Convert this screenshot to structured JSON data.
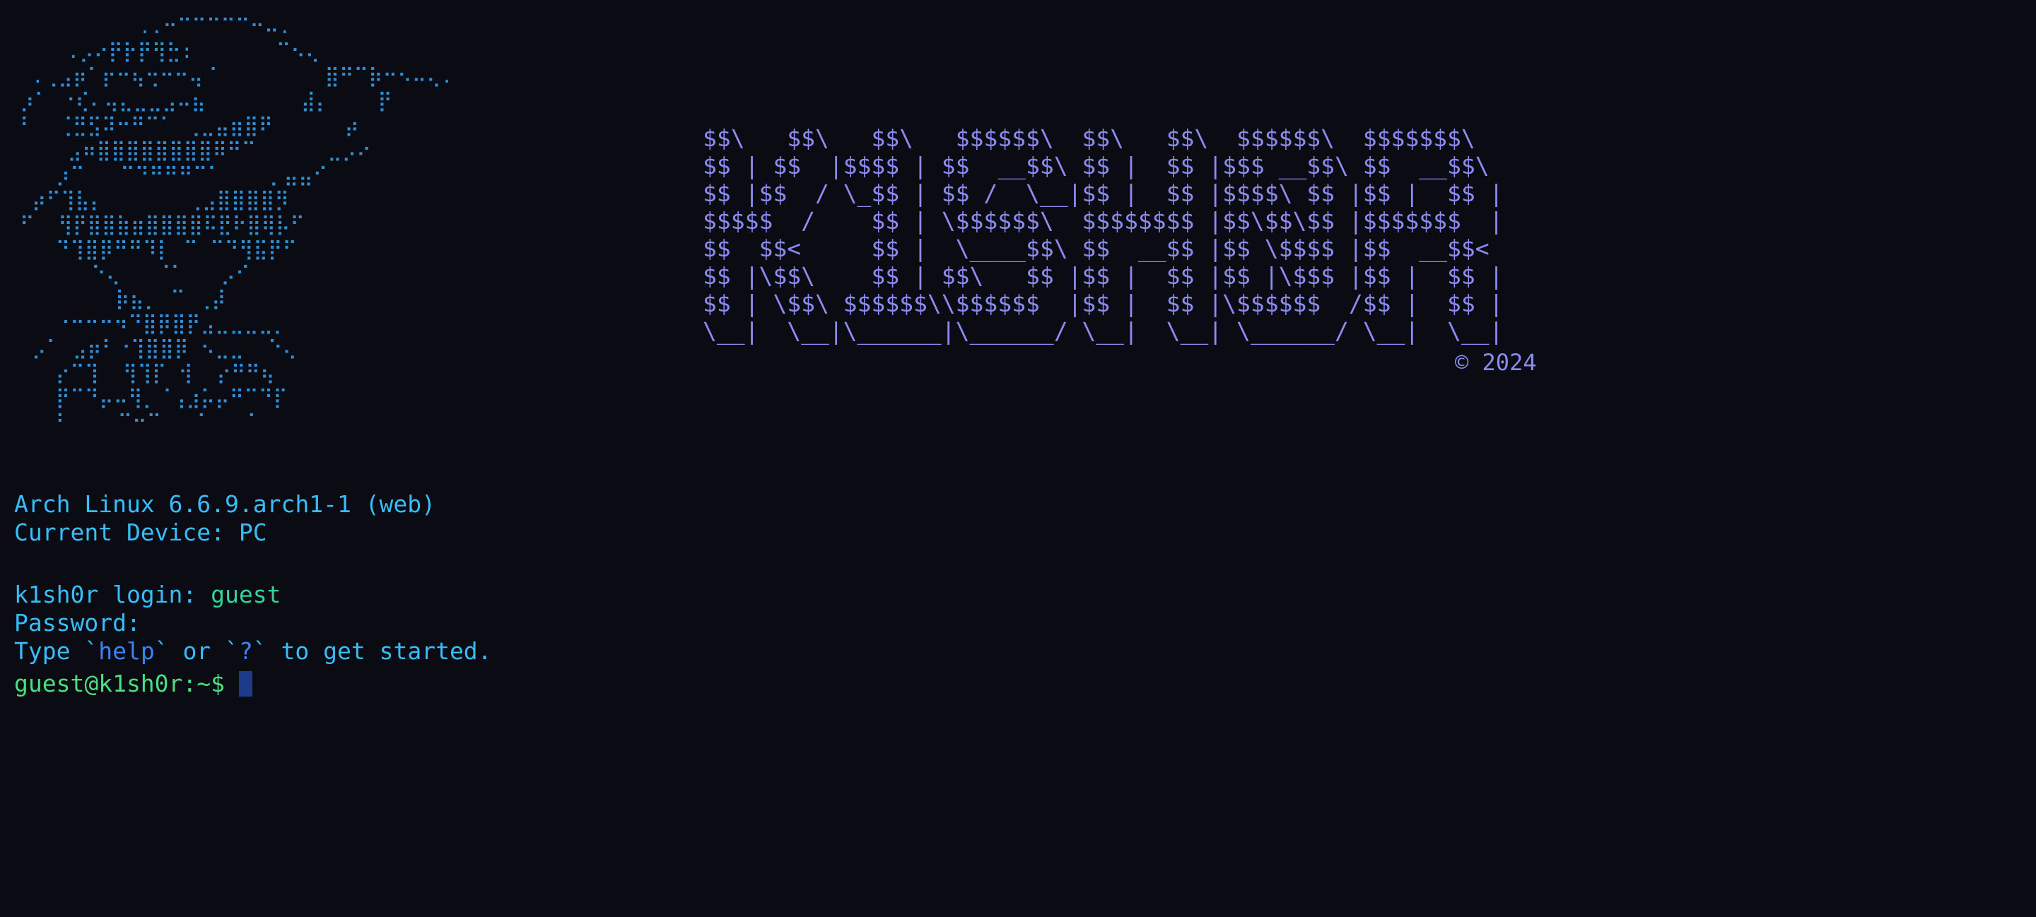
{
  "colors": {
    "background": "#0b0b14",
    "art": "#2f8fd6",
    "banner": "#8b8bf0",
    "info": "#38bdf8",
    "login": "#38bdf8",
    "login_value": "#34d399",
    "command_highlight": "#3b82f6",
    "prompt": "#4ade80",
    "cursor": "#1e3a8a"
  },
  "ascii_art": "          ..⠒⠉⠉⠉⠉⠉⠒⠤.\n    .⡠⠔⡟⡗⡟⢻⣓:       ⠉⠢⢄\n .⢀⣠⡶⠁⡖⠒⢦⢒⠒⠒⢤⠈         ⣿⠛⠉⡷⠒⠢⠤⢄.\n⡰⠁ ⠐⢎⠄⢤⣄⣀⣀⣠⠤⣦        ⣼⡄    ⡟\n⠃  ⢈⣛⣫⠽⠒⠛⠉⠁ ⢀⣀⣤⣶⣿⠟      ⡴\n    ⣠⠶⣿⣿⣿⣿⣿⣿⣿⣿⠿⠛⠉      ⣀⡠⠔\n   ⡰⠉   ⠉⠙⠛⠛⠛⠉⠁    ⡀⣤⣤⠊\n ⡴⠋⢹⣧⡄       ⢀⣠⣿⣿⣿⣿⡻\n⠋  ⢻⡟⣿⣿⣷⣶⣿⣿⣿⣿⠯⣟⠗⣿⢿⡧⠋\n   ⠙⢹⣿⡿⠛⠛⠹⡇ ⠉ ⠉⠙⢻⣯⡟⠋\n      ⠑⢄   ⠈⠁   ⡠⠊\n        ⡷⣦⡀ ⠉ ⢀⡼\n   ⠐⠒⠒⠒⠲⠙⣿⡿⣿⡟⣠⣀⣀⣀⣀⡀\n ⡠⠁ ⣠⡶⠃⠐⢹⣿⣿⡿ ⠢⣀⣀  ⠑⢄\n   ⡔⠉⢹  ⢻⢹⡏ ⢺  ⡔⠛⠛⢦\n   ⡟⠉⠙⡤⠤⢻⡀⠈⢠⣰⡥⡤⠛⠉⠙⡏\n   ⠃    ⠉⠒⠉   ⠁   ⠁",
  "banner_lines": [
    "$$\\   $$\\   $$\\   $$$$$$\\  $$\\   $$\\  $$$$$$\\  $$$$$$$\\",
    "$$ | $$  |$$$$ | $$  __$$\\ $$ |  $$ |$$$ __$$\\ $$  __$$\\",
    "$$ |$$  / \\_$$ | $$ /  \\__|$$ |  $$ |$$$$\\ $$ |$$ |  $$ |",
    "$$$$$  /    $$ | \\$$$$$$\\  $$$$$$$$ |$$\\$$\\$$ |$$$$$$$  |",
    "$$  $$<     $$ |  \\____$$\\ $$  __$$ |$$ \\$$$$ |$$  __$$<",
    "$$ |\\$$\\    $$ | $$\\   $$ |$$ |  $$ |$$ |\\$$$ |$$ |  $$ |",
    "$$ | \\$$\\ $$$$$$\\\\$$$$$$  |$$ |  $$ |\\$$$$$$  /$$ |  $$ |",
    "\\__|  \\__|\\______|\\______/ \\__|  \\__| \\______/ \\__|  \\__|"
  ],
  "copyright": "© 2024",
  "system_line": "Arch Linux 6.6.9.arch1-1 (web)",
  "device_line": "Current Device: PC",
  "login_label": "k1sh0r login: ",
  "login_value": "guest",
  "password_label": "Password:",
  "help": {
    "prefix": "Type `",
    "cmd1": "help",
    "middle1": "` or `",
    "cmd2": "?",
    "suffix": "` to get started."
  },
  "prompt": "guest@k1sh0r:~$"
}
